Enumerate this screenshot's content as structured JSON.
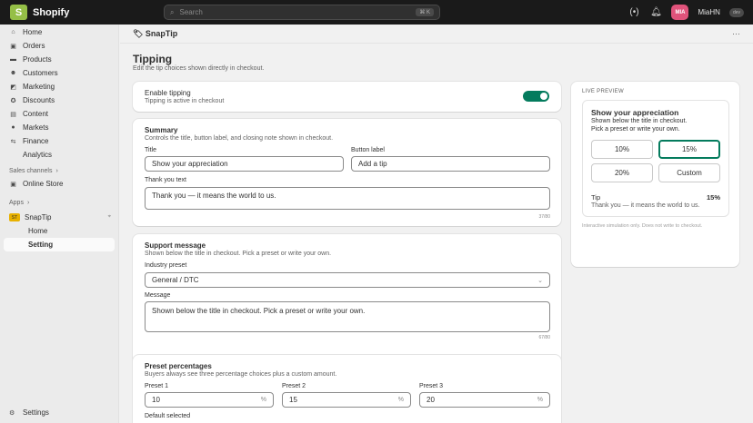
{
  "topbar": {
    "brand": "Shopify",
    "search_placeholder": "Search",
    "search_shortcut": "⌘ K",
    "avatar_initials": "MIA",
    "store_name": "MiaHN",
    "store_badge": "dev"
  },
  "sidebar": {
    "items": [
      {
        "label": "Home",
        "icon": "home-icon"
      },
      {
        "label": "Orders",
        "icon": "orders-icon"
      },
      {
        "label": "Products",
        "icon": "products-icon"
      },
      {
        "label": "Customers",
        "icon": "customers-icon"
      },
      {
        "label": "Marketing",
        "icon": "marketing-icon"
      },
      {
        "label": "Discounts",
        "icon": "discounts-icon"
      },
      {
        "label": "Content",
        "icon": "content-icon"
      },
      {
        "label": "Markets",
        "icon": "markets-icon"
      },
      {
        "label": "Finance",
        "icon": "finance-icon"
      },
      {
        "label": "Analytics",
        "icon": "analytics-icon"
      }
    ],
    "sales_channels_label": "Sales channels",
    "online_store": "Online Store",
    "apps_label": "Apps",
    "app_name": "SnapTip",
    "app_badge": "ST",
    "app_sub_home": "Home",
    "app_sub_setting": "Setting",
    "settings": "Settings"
  },
  "appbar": {
    "title": "🏷 SnapTip",
    "more": "···"
  },
  "page": {
    "title": "Tipping",
    "subtitle": "Edit the tip choices shown directly in checkout."
  },
  "enable": {
    "title": "Enable tipping",
    "status": "Tipping is active in checkout",
    "on": true
  },
  "summary": {
    "title": "Summary",
    "subtitle": "Controls the title, button label, and closing note shown in checkout.",
    "title_label": "Title",
    "title_value": "Show your appreciation",
    "button_label_label": "Button label",
    "button_label_value": "Add a tip",
    "thanks_label": "Thank you text",
    "thanks_value": "Thank you — it means the world to us.",
    "thanks_counter": "37/80"
  },
  "support": {
    "title": "Support message",
    "subtitle": "Shown below the title in checkout. Pick a preset or write your own.",
    "industry_label": "Industry preset",
    "industry_value": "General / DTC",
    "message_label": "Message",
    "message_value": "Shown below the title in checkout. Pick a preset or write your own.",
    "message_counter": "67/80"
  },
  "presets": {
    "title": "Preset percentages",
    "subtitle": "Buyers always see three percentage choices plus a custom amount.",
    "p1_label": "Preset 1",
    "p1_value": "10",
    "p2_label": "Preset 2",
    "p2_value": "15",
    "p3_label": "Preset 3",
    "p3_value": "20",
    "suffix": "%",
    "default_label": "Default selected"
  },
  "preview": {
    "label": "LIVE PREVIEW",
    "title": "Show your appreciation",
    "line1": "Shown below the title in checkout.",
    "line2": "Pick a preset or write your own.",
    "options": [
      "10%",
      "15%",
      "20%",
      "Custom"
    ],
    "selected_index": 1,
    "tip_label": "Tip",
    "tip_value": "15%",
    "thanks": "Thank you — it means the world to us.",
    "note": "Interactive simulation only. Does not write to checkout."
  },
  "colors": {
    "accent": "#047b5d",
    "topbar": "#1a1a1a",
    "avatar": "#e0537b",
    "logo": "#95bf47"
  }
}
